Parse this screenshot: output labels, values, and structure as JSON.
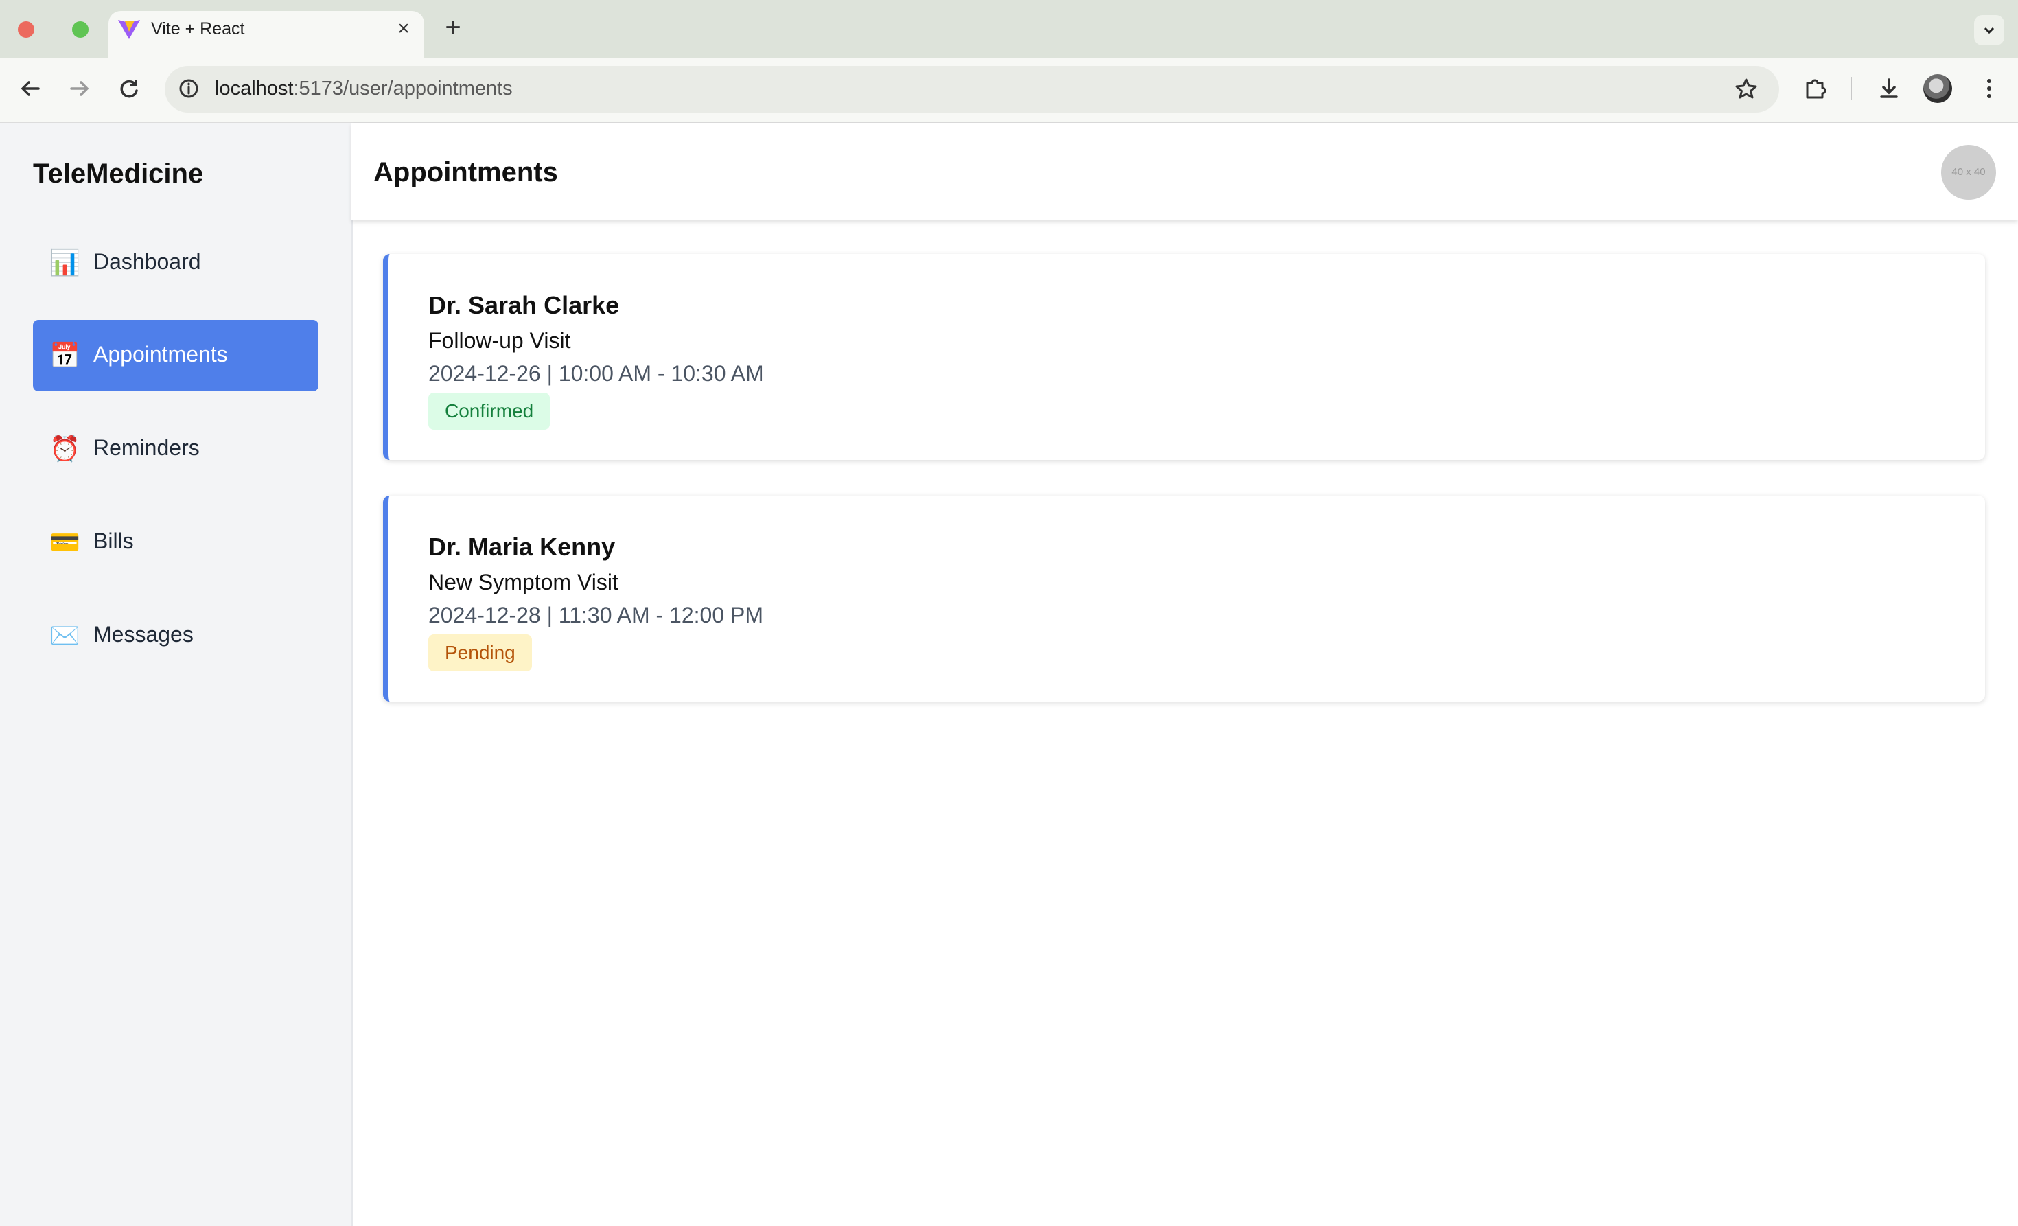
{
  "browser": {
    "tab_title": "Vite + React",
    "url_host": "localhost",
    "url_rest": ":5173/user/appointments"
  },
  "app": {
    "brand": "TeleMedicine",
    "nav": [
      {
        "label": "Dashboard",
        "icon": "📊",
        "icon_name": "bar-chart-icon",
        "active": false
      },
      {
        "label": "Appointments",
        "icon": "📅",
        "icon_name": "calendar-icon",
        "active": true
      },
      {
        "label": "Reminders",
        "icon": "⏰",
        "icon_name": "alarm-clock-icon",
        "active": false
      },
      {
        "label": "Bills",
        "icon": "💳",
        "icon_name": "credit-card-icon",
        "active": false
      },
      {
        "label": "Messages",
        "icon": "✉️",
        "icon_name": "envelope-icon",
        "active": false
      }
    ],
    "page_title": "Appointments",
    "avatar_text": "40 x 40",
    "appointments": [
      {
        "doctor": "Dr. Sarah Clarke",
        "type": "Follow-up Visit",
        "datetime": "2024-12-26 | 10:00 AM - 10:30 AM",
        "status": "Confirmed"
      },
      {
        "doctor": "Dr. Maria Kenny",
        "type": "New Symptom Visit",
        "datetime": "2024-12-28 | 11:30 AM - 12:00 PM",
        "status": "Pending"
      }
    ]
  },
  "colors": {
    "accent": "#4f7fea",
    "confirmed_bg": "#dcfce7",
    "confirmed_text": "#15803d",
    "pending_bg": "#fef3c7",
    "pending_text": "#b45309"
  }
}
